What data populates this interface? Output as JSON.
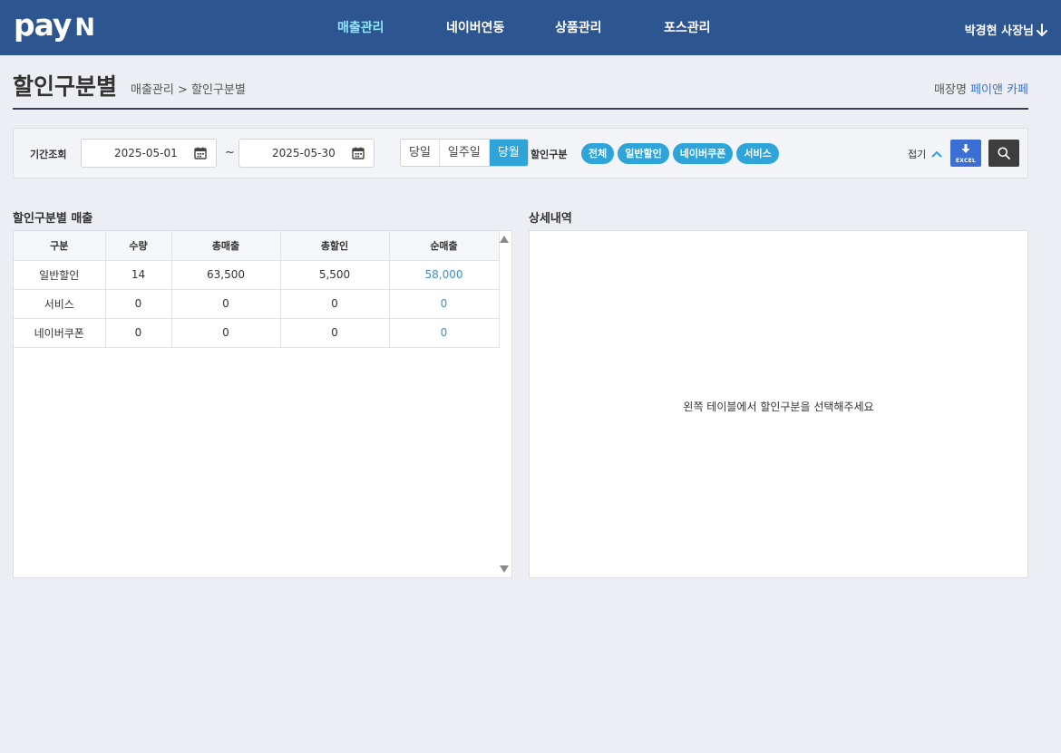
{
  "header": {
    "logo_main": "pay",
    "logo_n": "N",
    "nav": [
      {
        "label": "매출관리",
        "active": true
      },
      {
        "label": "네이버연동",
        "active": false
      },
      {
        "label": "상품관리",
        "active": false
      },
      {
        "label": "포스관리",
        "active": false
      }
    ],
    "user_label": "박경현 사장님"
  },
  "page": {
    "title": "할인구분별",
    "breadcrumb": "매출관리 > 할인구분별",
    "store_label": "매장명",
    "store_name": "페이앤 카페"
  },
  "filter": {
    "period_label": "기간조회",
    "start_date": "2025-05-01",
    "end_date": "2025-05-30",
    "separator": "~",
    "ranges": [
      {
        "label": "당일",
        "on": false
      },
      {
        "label": "일주일",
        "on": false
      },
      {
        "label": "당월",
        "on": true
      }
    ],
    "discount_label": "할인구분",
    "chips": [
      "전체",
      "일반할인",
      "네이버쿠폰",
      "서비스"
    ],
    "fold_label": "접기",
    "excel_label": "EXCEL"
  },
  "left_panel": {
    "title": "할인구분별 매출",
    "columns": [
      "구분",
      "수량",
      "총매출",
      "총할인",
      "순매출"
    ],
    "rows": [
      [
        "일반할인",
        "14",
        "63,500",
        "5,500",
        "58,000"
      ],
      [
        "서비스",
        "0",
        "0",
        "0",
        "0"
      ],
      [
        "네이버쿠폰",
        "0",
        "0",
        "0",
        "0"
      ]
    ]
  },
  "right_panel": {
    "title": "상세내역",
    "empty_message": "왼쪽 테이블에서 할인구분을 선택해주세요"
  },
  "colors": {
    "header_bg": "#2d5590",
    "nav_active": "#8ee6ff",
    "accent": "#2fa4d9",
    "excel": "#3c6fd6",
    "net_value": "#3a8fd0"
  }
}
